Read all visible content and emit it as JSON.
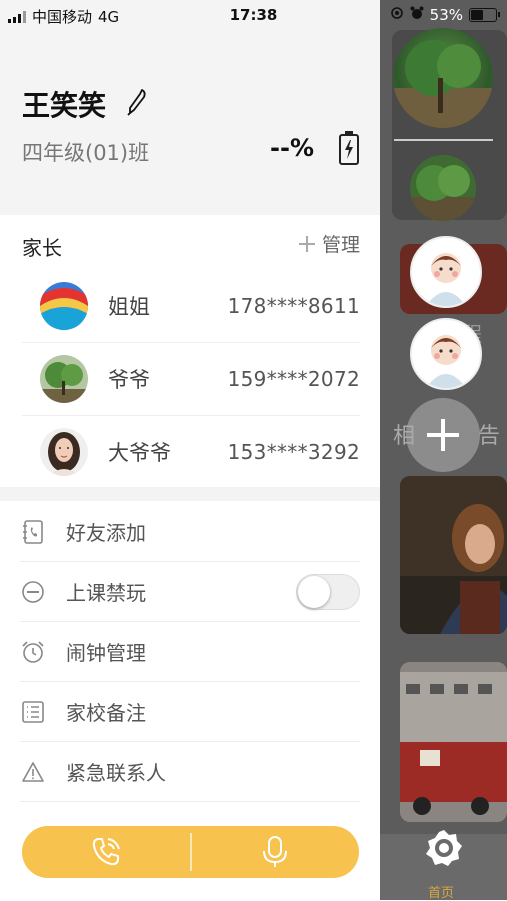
{
  "status_bar": {
    "carrier": "中国移动",
    "network": "4G",
    "time": "17:38",
    "battery_percent": "53%",
    "battery_level": 0.53
  },
  "profile": {
    "name": "王笑笑",
    "class": "四年级(01)班",
    "battery_reading": "--%"
  },
  "parents": {
    "title": "家长",
    "manage_label": "管理",
    "contacts": [
      {
        "name": "姐姐",
        "phone": "178****8611",
        "avatar": "rainbow-avatar"
      },
      {
        "name": "爷爷",
        "phone": "159****2072",
        "avatar": "tree-avatar"
      },
      {
        "name": "大爷爷",
        "phone": "153****3292",
        "avatar": "woman-avatar"
      }
    ]
  },
  "menu": [
    {
      "label": "好友添加",
      "icon": "phonebook-icon"
    },
    {
      "label": "上课禁玩",
      "icon": "minus-circle-icon",
      "toggle": false
    },
    {
      "label": "闹钟管理",
      "icon": "alarm-clock-icon"
    },
    {
      "label": "家校备注",
      "icon": "list-icon"
    },
    {
      "label": "紧急联系人",
      "icon": "warning-icon"
    }
  ],
  "call_bar": {
    "left_icon": "phone-icon",
    "right_icon": "microphone-icon",
    "color": "#f7c24d"
  },
  "background": {
    "partial_text_1": "程",
    "partial_text_2": "相",
    "partial_text_3": "告",
    "tab_label": "首页"
  }
}
